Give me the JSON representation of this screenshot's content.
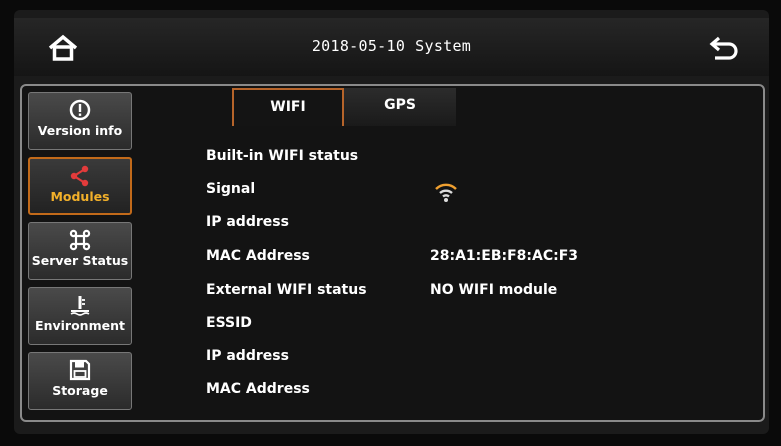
{
  "header": {
    "date": "2018-05-10",
    "title": "System"
  },
  "sidebar": {
    "items": [
      {
        "label": "Version info",
        "icon": "info-circle-icon",
        "active": false
      },
      {
        "label": "Modules",
        "icon": "share-icon",
        "active": true
      },
      {
        "label": "Server Status",
        "icon": "command-icon",
        "active": false
      },
      {
        "label": "Environment",
        "icon": "thermometer-icon",
        "active": false
      },
      {
        "label": "Storage",
        "icon": "floppy-disk-icon",
        "active": false
      }
    ]
  },
  "tabs": [
    {
      "label": "WIFI",
      "active": true
    },
    {
      "label": "GPS",
      "active": false
    }
  ],
  "rows": [
    {
      "label": "Built-in WIFI status",
      "value": ""
    },
    {
      "label": "Signal",
      "value": ""
    },
    {
      "label": "IP address",
      "value": ""
    },
    {
      "label": "MAC Address",
      "value": "28:A1:EB:F8:AC:F3"
    },
    {
      "label": "External WIFI status",
      "value": "NO WIFI module"
    },
    {
      "label": "ESSID",
      "value": ""
    },
    {
      "label": "IP address",
      "value": ""
    },
    {
      "label": "MAC Address",
      "value": ""
    }
  ],
  "colors": {
    "accent": "#c26a1a",
    "active_label": "#f2b02a",
    "signal": "#f0a030"
  },
  "signal_icon": "wifi-signal-icon"
}
